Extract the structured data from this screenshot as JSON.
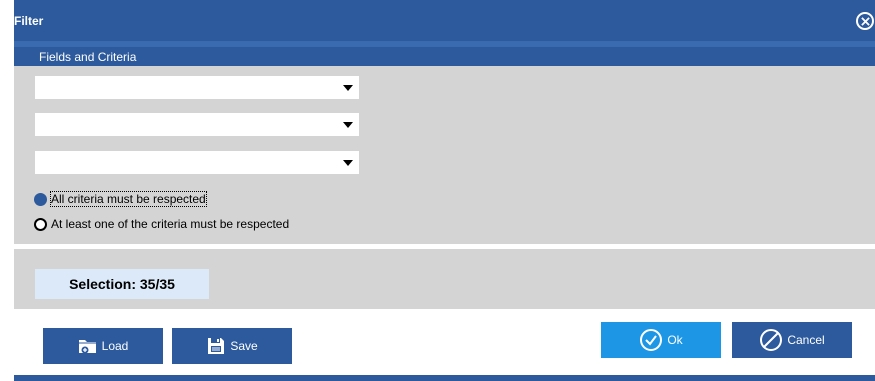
{
  "window": {
    "title": "Filter"
  },
  "section": {
    "label": "Fields and Criteria"
  },
  "criteria": [
    {
      "value": ""
    },
    {
      "value": ""
    },
    {
      "value": ""
    }
  ],
  "match": {
    "all_label": "All criteria must be respected",
    "any_label": "At least one of the criteria must be respected",
    "selected": "all"
  },
  "selection": {
    "text": "Selection: 35/35"
  },
  "buttons": {
    "load": "Load",
    "save": "Save",
    "ok": "Ok",
    "cancel": "Cancel"
  },
  "icons": {
    "close": "close-icon",
    "load": "folder-open-icon",
    "save": "floppy-disk-icon",
    "ok": "check-circle-icon",
    "cancel": "prohibit-icon"
  },
  "colors": {
    "accent": "#2c5a9c",
    "ok_button": "#1e96e6",
    "panel": "#d4d4d4",
    "selection_bg": "#dbe9f8"
  }
}
